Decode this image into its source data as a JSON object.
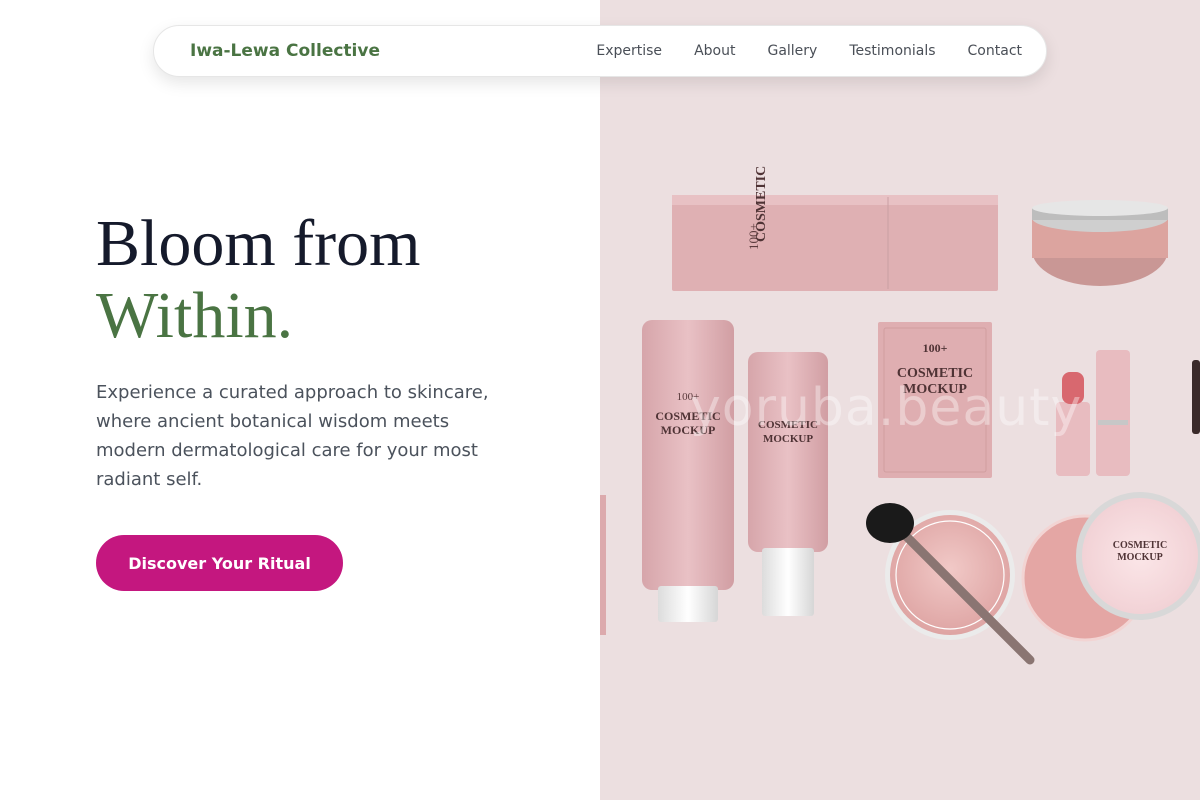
{
  "nav": {
    "brand": "Iwa-Lewa Collective",
    "links": [
      "Expertise",
      "About",
      "Gallery",
      "Testimonials",
      "Contact"
    ]
  },
  "hero": {
    "title_line1": "Bloom from",
    "title_line2": "Within.",
    "description": "Experience a curated approach to skincare, where ancient botanical wisdom meets modern dermatological care for your most radiant self.",
    "cta_label": "Discover Your Ritual"
  },
  "image": {
    "watermark": "yoruba.beauty",
    "box_text": "100+",
    "box_text2": "COSMETIC MOCKUP",
    "pouch_text": "100+",
    "pouch_text2": "COSMETIC MOCKUP"
  },
  "colors": {
    "brand_green": "#4a7443",
    "cta_magenta": "#c4177f",
    "image_bg": "#ecdfe0",
    "product_pink": "#e2b3b6"
  },
  "icons": [
    "cosmetics-photo"
  ]
}
